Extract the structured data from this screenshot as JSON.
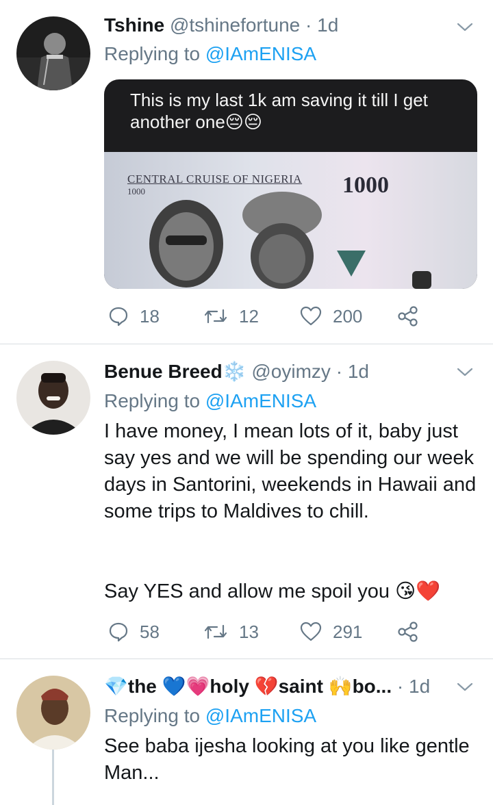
{
  "tweets": [
    {
      "name": "Tshine",
      "handle": "@tshinefortune",
      "separator": "·",
      "time": "1d",
      "replying_prefix": "Replying to",
      "replying_to": "@IAmENISA",
      "media": {
        "caption": "This is my last 1k am saving it till I get another one😔😔",
        "note_title": "CENTRAL CRUISE OF NIGERIA",
        "note_small": "1000",
        "note_value": "1000"
      },
      "counts": {
        "replies": "18",
        "retweets": "12",
        "likes": "200"
      }
    },
    {
      "name": "Benue Breed",
      "name_emoji": "❄️",
      "handle": "@oyimzy",
      "separator": "·",
      "time": "1d",
      "replying_prefix": "Replying to",
      "replying_to": "@IAmENISA",
      "text_p1": "I have money, I mean lots of it, baby just say yes and we will be spending our week days in Santorini, weekends in Hawaii and some trips to Maldives to chill.",
      "text_p2": "Say YES and allow me spoil you 😘❤️",
      "counts": {
        "replies": "58",
        "retweets": "13",
        "likes": "291"
      }
    },
    {
      "name": "💎the 💙💗holy 💔saint 🙌bo...",
      "separator": "·",
      "time": "1d",
      "replying_prefix": "Replying to",
      "replying_to": "@IAmENISA",
      "text": "See baba ijesha looking at you like gentle Man..."
    }
  ],
  "icons": {
    "reply": "reply-icon",
    "retweet": "retweet-icon",
    "like": "heart-icon",
    "share": "share-icon",
    "more": "chevron-down-icon"
  },
  "colors": {
    "muted": "#657786",
    "link": "#1da1f2",
    "text": "#14171a",
    "divider": "#d8dde1"
  }
}
